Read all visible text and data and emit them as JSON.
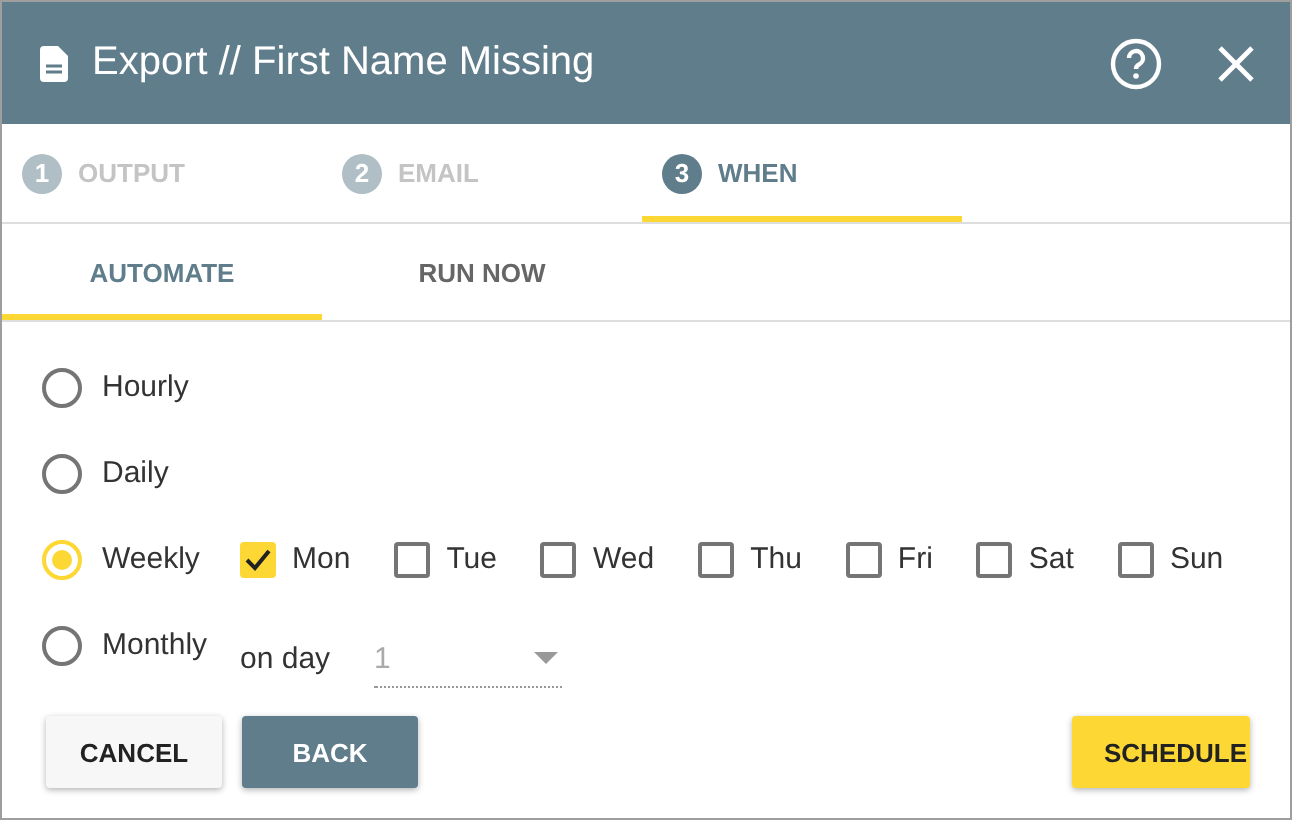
{
  "window": {
    "title": "Export // First Name Missing"
  },
  "steps": [
    {
      "number": "1",
      "label": "OUTPUT",
      "selected": false
    },
    {
      "number": "2",
      "label": "EMAIL",
      "selected": false
    },
    {
      "number": "3",
      "label": "WHEN",
      "selected": true
    }
  ],
  "tabs": [
    {
      "label": "AUTOMATE",
      "selected": true
    },
    {
      "label": "RUN NOW",
      "selected": false
    }
  ],
  "frequencies": [
    {
      "label": "Hourly",
      "selected": false,
      "kind": "plain"
    },
    {
      "label": "Daily",
      "selected": false,
      "kind": "plain"
    },
    {
      "label": "Weekly",
      "selected": true,
      "kind": "days"
    },
    {
      "label": "Monthly",
      "selected": false,
      "kind": "monthly"
    }
  ],
  "days": [
    {
      "label": "Mon",
      "checked": true
    },
    {
      "label": "Tue",
      "checked": false
    },
    {
      "label": "Wed",
      "checked": false
    },
    {
      "label": "Thu",
      "checked": false
    },
    {
      "label": "Fri",
      "checked": false
    },
    {
      "label": "Sat",
      "checked": false
    },
    {
      "label": "Sun",
      "checked": false
    }
  ],
  "monthly": {
    "label": "on day",
    "value": "1",
    "disabled": true
  },
  "buttons": [
    {
      "label": "CANCEL",
      "kind": "flat"
    },
    {
      "label": "BACK",
      "kind": "primary"
    },
    {
      "label": "SCHEDULE",
      "kind": "accent"
    }
  ]
}
